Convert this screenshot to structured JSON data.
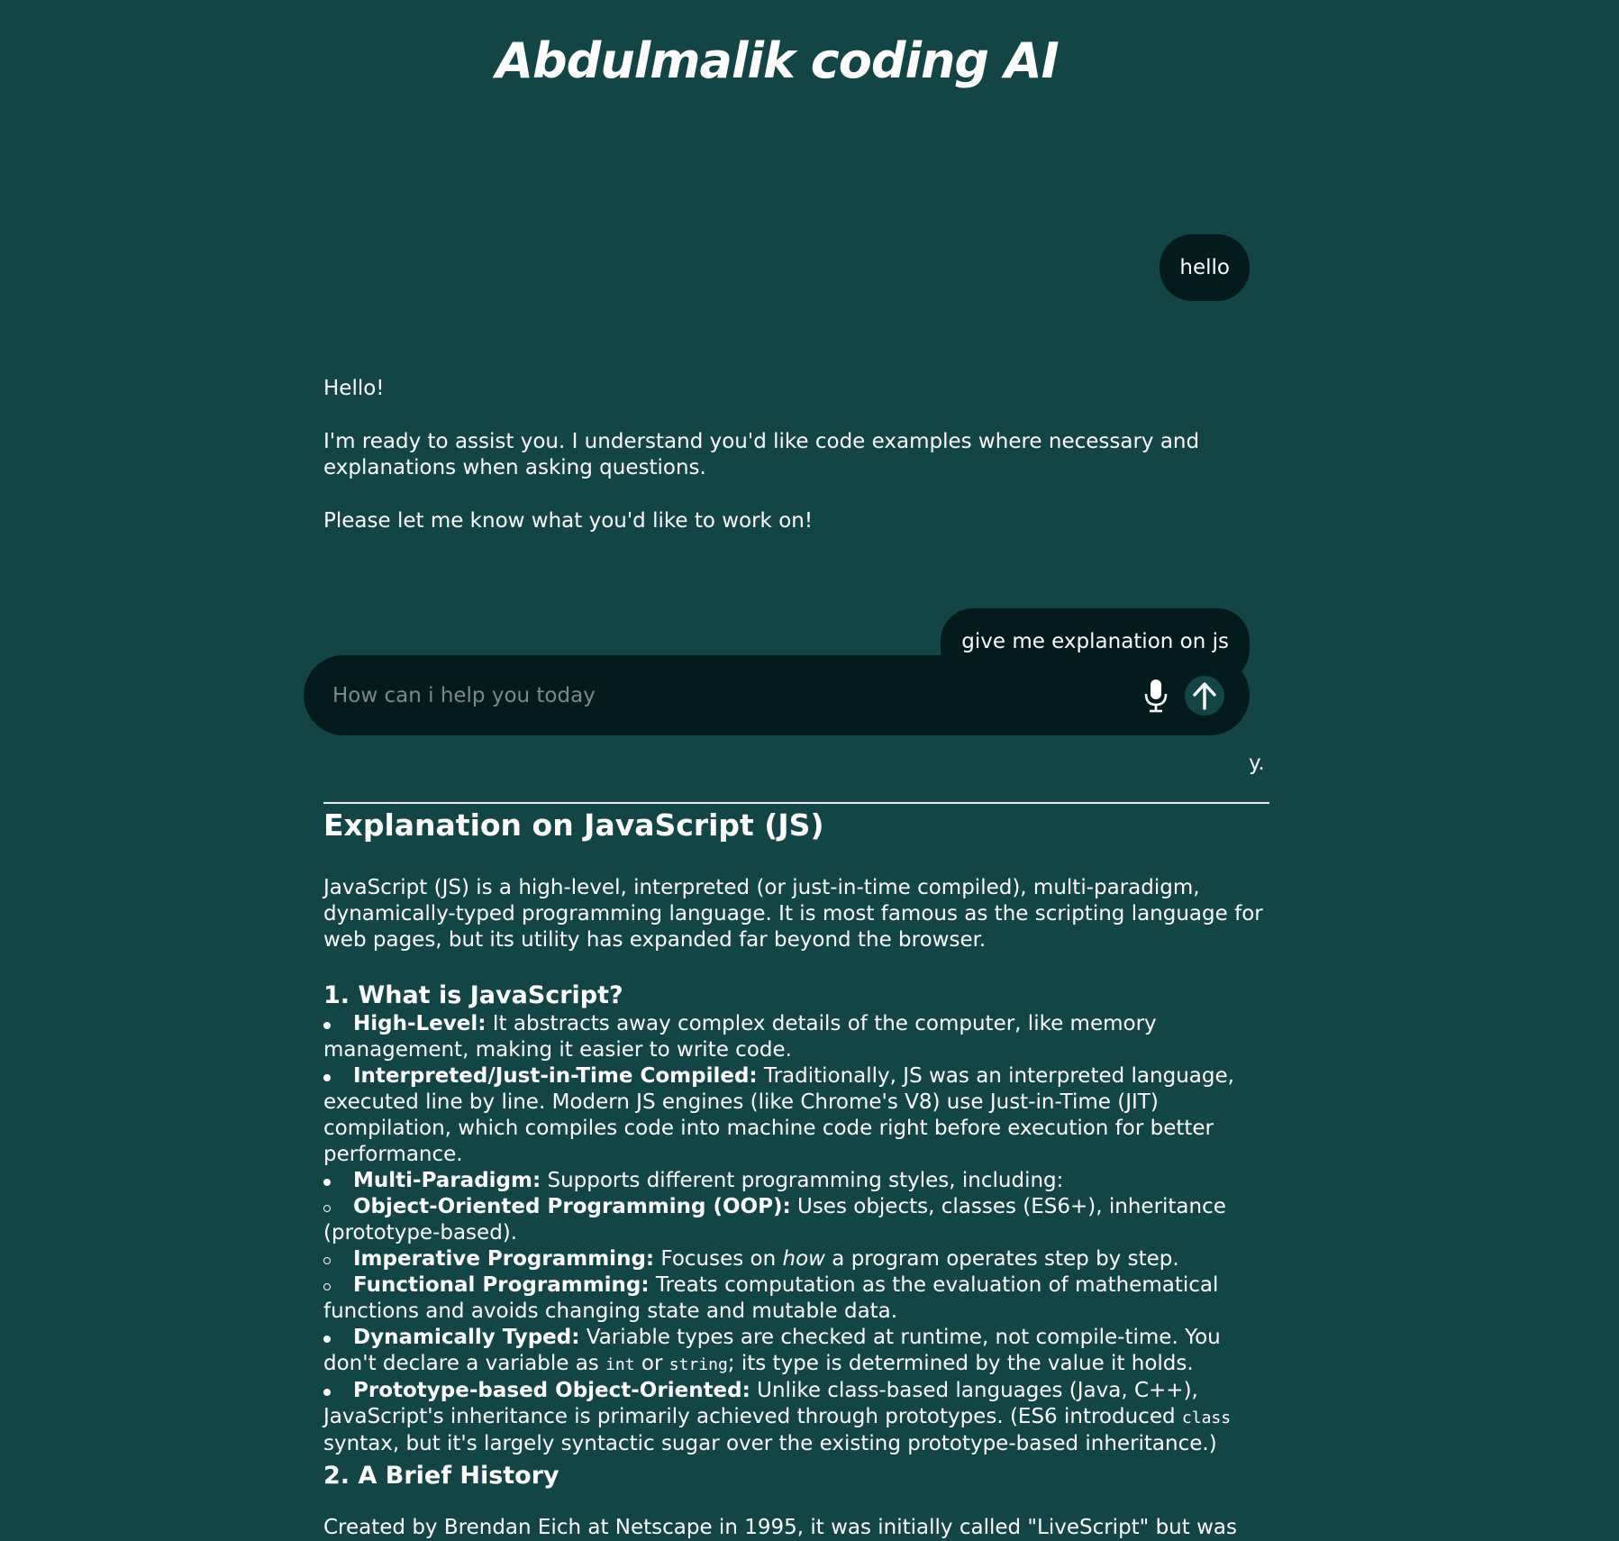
{
  "app": {
    "title": "Abdulmalik coding AI"
  },
  "conversation": {
    "user_message_1": "hello",
    "ai_reply_1": {
      "p1": "Hello!",
      "p2": "I'm ready to assist you. I understand you'd like code examples where necessary and explanations when asking questions.",
      "p3": "Please let me know what you'd like to work on!"
    },
    "user_message_2": "give me explanation on js",
    "partial_text": "y.",
    "ai_reply_2": {
      "heading": "Explanation on JavaScript (JS)",
      "intro": "JavaScript (JS) is a high-level, interpreted (or just-in-time compiled), multi-paradigm, dynamically-typed programming language. It is most famous as the scripting language for web pages, but its utility has expanded far beyond the browser.",
      "section1_heading": "1. What is JavaScript?",
      "items": [
        {
          "term": "High-Level:",
          "text": " It abstracts away complex details of the computer, like memory management, making it easier to write code."
        },
        {
          "term": "Interpreted/Just-in-Time Compiled:",
          "text": " Traditionally, JS was an interpreted language, executed line by line. Modern JS engines (like Chrome's V8) use Just-in-Time (JIT) compilation, which compiles code into machine code right before execution for better performance."
        },
        {
          "term": "Multi-Paradigm:",
          "text": " Supports different programming styles, including:"
        },
        {
          "term": "Object-Oriented Programming (OOP):",
          "text": " Uses objects, classes (ES6+), inheritance (prototype-based)."
        },
        {
          "term": "Imperative Programming:",
          "text_before": " Focuses on ",
          "em": "how",
          "text_after": " a program operates step by step."
        },
        {
          "term": "Functional Programming:",
          "text": " Treats computation as the evaluation of mathematical functions and avoids changing state and mutable data."
        },
        {
          "term": "Dynamically Typed:",
          "text_a": " Variable types are checked at runtime, not compile-time. You don't declare a variable as ",
          "code1": "int",
          "text_b": " or ",
          "code2": "string",
          "text_c": "; its type is determined by the value it holds."
        },
        {
          "term": "Prototype-based Object-Oriented:",
          "text_a": " Unlike class-based languages (Java, C++), JavaScript's inheritance is primarily achieved through prototypes. (ES6 introduced ",
          "code": "class",
          "text_b": " syntax, but it's largely syntactic sugar over the existing prototype-based inheritance.)"
        }
      ],
      "section2_heading": "2. A Brief History",
      "section2_text": "Created by Brendan Eich at Netscape in 1995, it was initially called \"LiveScript\" but was"
    }
  },
  "composer": {
    "placeholder": "How can i help you today",
    "mic_icon": "microphone-icon",
    "send_icon": "arrow-up-icon"
  },
  "colors": {
    "background": "#134546",
    "bubble": "#031b1c",
    "text": "#ffffff"
  }
}
